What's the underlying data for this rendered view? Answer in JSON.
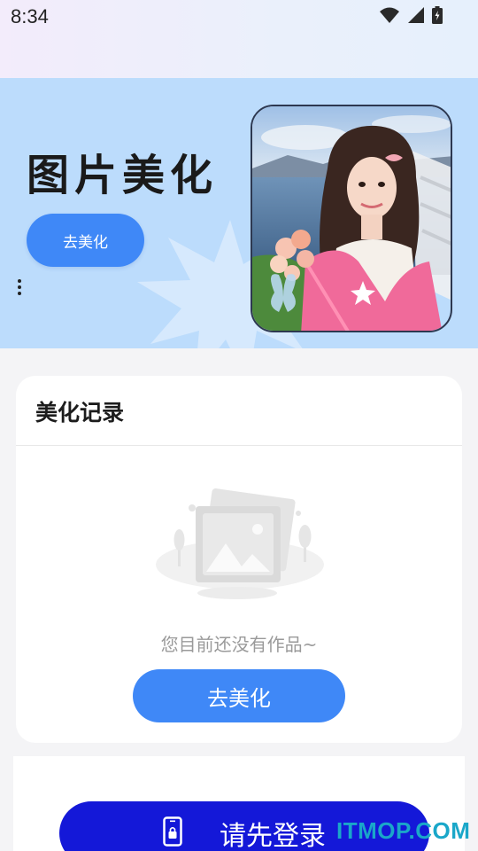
{
  "status_bar": {
    "time": "8:34",
    "icons": [
      "wifi-icon",
      "cell-signal-icon",
      "battery-icon"
    ]
  },
  "banner": {
    "title": "图片美化",
    "button_label": "去美化",
    "photo": "portrait-photo",
    "background_color": "#bcdcfc",
    "button_color": "#3f88f7"
  },
  "history": {
    "title": "美化记录",
    "empty_text": "您目前还没有作品~",
    "button_label": "去美化"
  },
  "login": {
    "button_label": "请先登录",
    "button_color": "#1418d8",
    "icon": "phone-lock-icon"
  },
  "watermark": "ITMOP.COM"
}
